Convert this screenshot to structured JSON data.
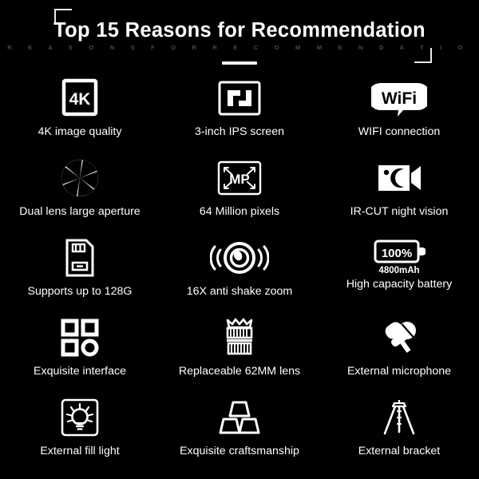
{
  "header": {
    "title": "Top 15 Reasons for Recommendation",
    "subtitle": "R E A S O N S   F O R   R E C O M M E N D A T I O N",
    "accent_color": "#ffffff",
    "background_color": "#000000",
    "subtitle_color": "#4a4a4a"
  },
  "features": [
    [
      {
        "icon": "4k-square-icon",
        "label": "4K image quality",
        "note": ""
      },
      {
        "icon": "screen-frame-icon",
        "label": "3-inch IPS screen",
        "note": ""
      },
      {
        "icon": "wifi-badge-icon",
        "label": "WIFI connection",
        "note": ""
      }
    ],
    [
      {
        "icon": "aperture-icon",
        "label": "Dual lens large aperture",
        "note": ""
      },
      {
        "icon": "megapixel-frame-icon",
        "label": "64 Million pixels",
        "note": ""
      },
      {
        "icon": "night-vision-camcorder-icon",
        "label": "IR-CUT night vision",
        "note": ""
      }
    ],
    [
      {
        "icon": "sd-card-icon",
        "label": "Supports up to 128G",
        "note": ""
      },
      {
        "icon": "anti-shake-lens-icon",
        "label": "16X anti shake zoom",
        "note": ""
      },
      {
        "icon": "battery-100-icon",
        "label": "High capacity battery",
        "note": "4800mAh"
      }
    ],
    [
      {
        "icon": "interface-grid-icon",
        "label": "Exquisite interface",
        "note": ""
      },
      {
        "icon": "lens-barrel-icon",
        "label": "Replaceable 62MM lens",
        "note": ""
      },
      {
        "icon": "microphone-icon",
        "label": "External microphone",
        "note": ""
      }
    ],
    [
      {
        "icon": "fill-light-bulb-icon",
        "label": "External fill light",
        "note": ""
      },
      {
        "icon": "gold-ingots-icon",
        "label": "Exquisite craftsmanship",
        "note": ""
      },
      {
        "icon": "tripod-icon",
        "label": "External bracket",
        "note": ""
      }
    ]
  ],
  "icon_text": {
    "four_k": "4K",
    "wifi": "WiFi",
    "megapixel": "MP",
    "battery_percent": "100%"
  }
}
